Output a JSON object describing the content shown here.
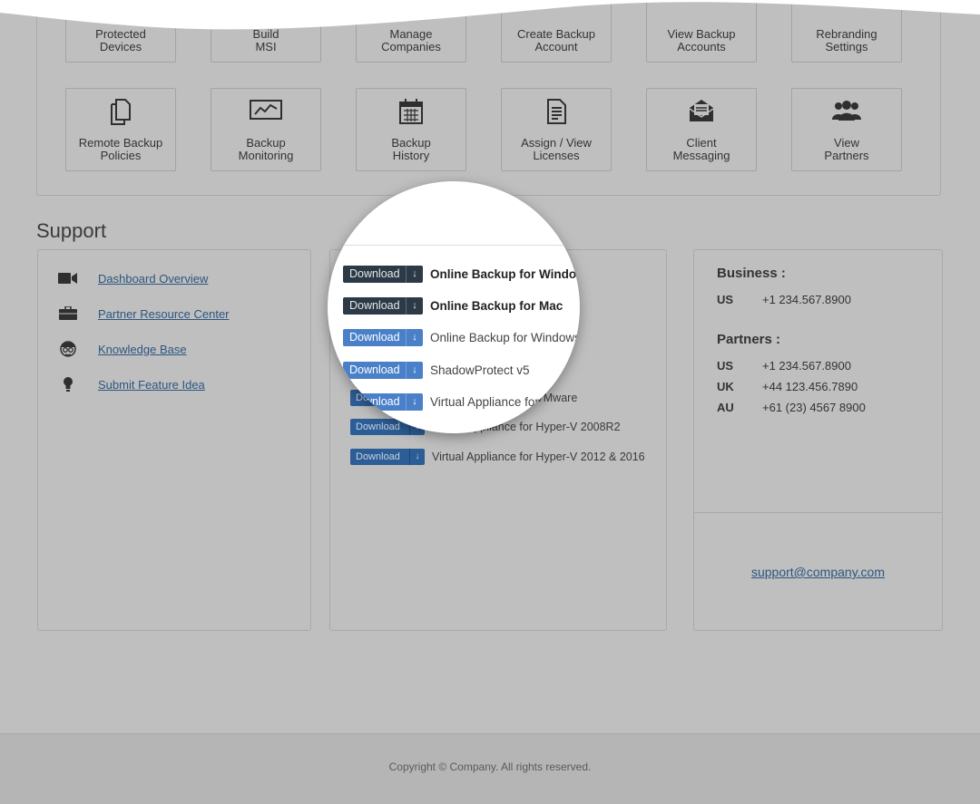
{
  "tiles_row1": [
    {
      "label": "Protected\nDevices",
      "icon": "protected-devices-icon"
    },
    {
      "label": "Build\nMSI",
      "icon": "build-msi-icon"
    },
    {
      "label": "Manage\nCompanies",
      "icon": "manage-companies-icon"
    },
    {
      "label": "Create Backup\nAccount",
      "icon": "create-account-icon"
    },
    {
      "label": "View Backup\nAccounts",
      "icon": "view-accounts-icon"
    },
    {
      "label": "Rebranding\nSettings",
      "icon": "rebranding-icon"
    }
  ],
  "tiles_row2": [
    {
      "label": "Remote Backup\nPolicies",
      "icon": "documents-icon"
    },
    {
      "label": "Backup\nMonitoring",
      "icon": "monitor-chart-icon"
    },
    {
      "label": "Backup\nHistory",
      "icon": "calendar-icon"
    },
    {
      "label": "Assign / View\nLicenses",
      "icon": "license-document-icon"
    },
    {
      "label": "Client\nMessaging",
      "icon": "envelope-icon"
    },
    {
      "label": "View\nPartners",
      "icon": "partners-icon"
    }
  ],
  "support": {
    "heading": "Support",
    "links": [
      {
        "label": "Dashboard Overview",
        "icon": "video-camera-icon"
      },
      {
        "label": "Partner Resource Center",
        "icon": "briefcase-icon"
      },
      {
        "label": "Knowledge Base",
        "icon": "nerd-face-icon"
      },
      {
        "label": "Submit Feature Idea",
        "icon": "lightbulb-icon"
      }
    ]
  },
  "downloads": {
    "button_label": "Download",
    "items_visible": [
      "Virtual Appliance for VMware",
      "Virtual Appliance for Hyper-V 2008R2",
      "Virtual Appliance for Hyper-V 2012 & 2016"
    ],
    "magnified": [
      {
        "name": "Online Backup for Windows",
        "style": "dark",
        "bold": true
      },
      {
        "name": "Online Backup for Mac",
        "style": "dark",
        "bold": true
      },
      {
        "name": "Online Backup for Windows (MSI)",
        "style": "light",
        "bold": false
      },
      {
        "name": "ShadowProtect v5",
        "style": "light",
        "bold": false
      },
      {
        "name": "Virtual Appliance for VMware",
        "style": "light",
        "bold": false
      }
    ]
  },
  "contact": {
    "business_title": "Business :",
    "business": [
      {
        "country": "US",
        "phone": "+1 234.567.8900"
      }
    ],
    "partners_title": "Partners :",
    "partners": [
      {
        "country": "US",
        "phone": "+1 234.567.8900"
      },
      {
        "country": "UK",
        "phone": "+44 123.456.7890"
      },
      {
        "country": "AU",
        "phone": "+61 (23) 4567 8900"
      }
    ],
    "email": "support@company.com"
  },
  "footer": {
    "copyright": "Copyright ©  Company.  All rights reserved."
  },
  "colors": {
    "background": "#bfbfbf",
    "link": "#2c5680",
    "download_button": "#2d5d96"
  }
}
